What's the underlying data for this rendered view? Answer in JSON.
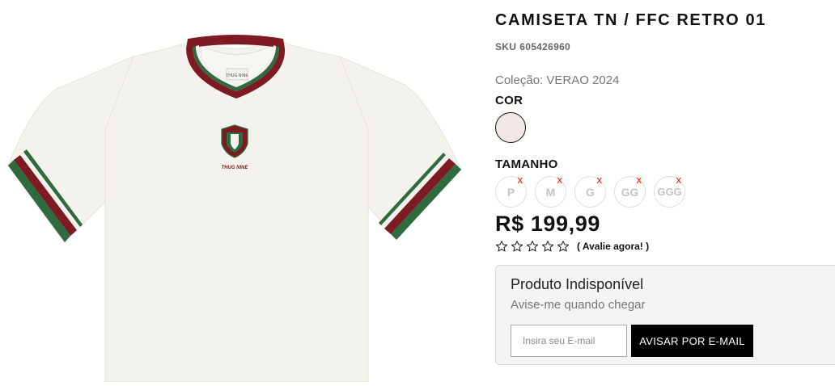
{
  "product": {
    "name": "CAMISETA TN / FFC RETRO 01",
    "sku_label": "SKU",
    "sku_value": "605426960",
    "collection_label": "Coleção: VERAO 2024",
    "image_alt": "Camiseta branca com gola e punhos listrados",
    "brand_tag": "THUG NINE",
    "chest_text": "THUG NINE"
  },
  "color": {
    "label": "COR",
    "swatch_color": "#efe8e4"
  },
  "size": {
    "label": "TAMANHO",
    "options": [
      {
        "label": "P",
        "available": false
      },
      {
        "label": "M",
        "available": false
      },
      {
        "label": "G",
        "available": false
      },
      {
        "label": "GG",
        "available": false
      },
      {
        "label": "GGG",
        "available": false
      }
    ],
    "unavailable_mark": "x"
  },
  "price": "R$ 199,99",
  "rating": {
    "stars": 0,
    "max": 5,
    "link_label": "( Avalie agora! )"
  },
  "notify": {
    "title": "Produto Indisponível",
    "subtitle": "Avise-me quando chegar",
    "email_placeholder": "Insira seu E-mail",
    "button_label": "AVISAR POR E-MAIL"
  },
  "colors": {
    "shirt": "#f4f2ec",
    "stripe_red": "#7d1a22",
    "stripe_green": "#2e6b3f",
    "unavailable_x": "#e01111"
  }
}
